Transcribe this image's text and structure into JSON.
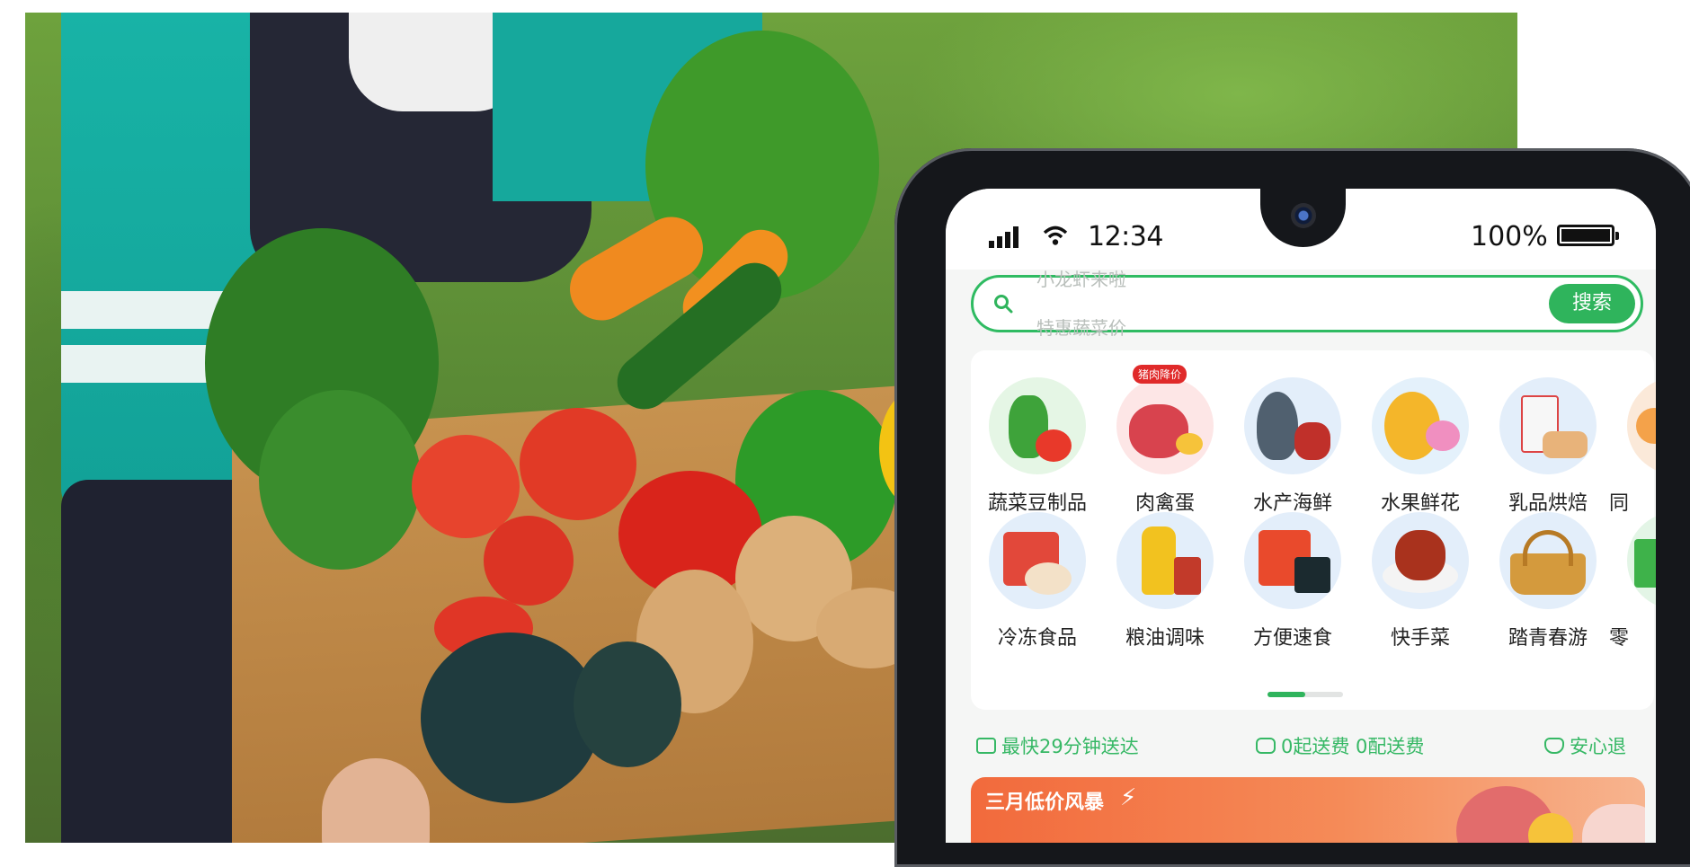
{
  "status_bar": {
    "time": "12:34",
    "battery": "100%"
  },
  "search": {
    "placeholder_top": "小龙虾来啦",
    "placeholder_bottom": "特惠蔬菜价",
    "button": "搜索"
  },
  "categories": [
    {
      "label": "蔬菜豆制品",
      "icon": "vegetables-icon",
      "badge": ""
    },
    {
      "label": "肉禽蛋",
      "icon": "meat-egg-icon",
      "badge": "猪肉降价"
    },
    {
      "label": "水产海鲜",
      "icon": "seafood-icon",
      "badge": ""
    },
    {
      "label": "水果鲜花",
      "icon": "fruit-flower-icon",
      "badge": ""
    },
    {
      "label": "乳品烘焙",
      "icon": "dairy-bakery-icon",
      "badge": ""
    },
    {
      "label": "冷冻食品",
      "icon": "frozen-food-icon",
      "badge": ""
    },
    {
      "label": "粮油调味",
      "icon": "grain-oil-icon",
      "badge": ""
    },
    {
      "label": "方便速食",
      "icon": "instant-food-icon",
      "badge": ""
    },
    {
      "label": "快手菜",
      "icon": "quick-dish-icon",
      "badge": ""
    },
    {
      "label": "踏青春游",
      "icon": "picnic-basket-icon",
      "badge": ""
    }
  ],
  "categories_partial": [
    "同",
    "零"
  ],
  "promises": [
    "最快29分钟送达",
    "0起送费 0配送费",
    "安心退"
  ],
  "banner": {
    "title": "三月低价风暴"
  },
  "colors": {
    "brand_green": "#2fb45c",
    "banner_orange": "#f26a3c"
  }
}
